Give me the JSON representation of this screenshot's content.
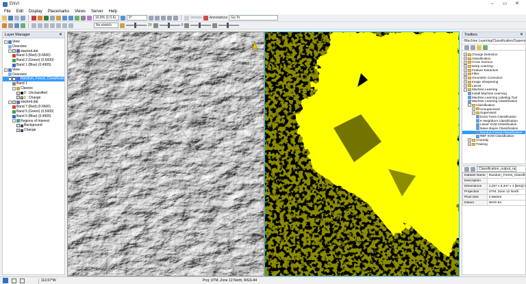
{
  "window": {
    "title": "ENVI",
    "buttons": [
      "–",
      "▭",
      "✕"
    ]
  },
  "menu": [
    "File",
    "Edit",
    "Display",
    "Placemarks",
    "Views",
    "Server",
    "Help"
  ],
  "toolbar1": {
    "zoom": "16.8% (1:0.6)",
    "rotation": "0°",
    "vectors": "Vectors",
    "annotations": "Annotations",
    "goto": "Go To"
  },
  "toolbar2": {
    "stretch": "No stretch",
    "value_a": "20",
    "value_b": "0"
  },
  "layer_manager": {
    "title": "Layer Manager",
    "tree": [
      {
        "label": "View",
        "level": 0,
        "exp": "−",
        "icon": "view"
      },
      {
        "label": "Overview",
        "level": 1,
        "icon": "overview"
      },
      {
        "label": "stacked.dat",
        "level": 1,
        "exp": "−",
        "check": true,
        "icon": "raster"
      },
      {
        "label": "Band 3 (Red) (0.6600)",
        "level": 2,
        "icon": "red-band"
      },
      {
        "label": "Band 2 (Green) (0.5600)",
        "level": 2,
        "icon": "green-band"
      },
      {
        "label": "Band 1 (Blue) (0.4905)",
        "level": 2,
        "icon": "blue-band"
      },
      {
        "label": "View",
        "level": 0,
        "exp": "−",
        "icon": "view"
      },
      {
        "label": "Overview",
        "level": 1,
        "icon": "overview"
      },
      {
        "label": "Random_Forest_Classification_",
        "level": 1,
        "exp": "−",
        "check": true,
        "icon": "raster",
        "selected": true
      },
      {
        "label": "Band 1",
        "level": 2,
        "icon": "gray-band"
      },
      {
        "label": "Classes",
        "level": 2,
        "exp": "−",
        "icon": "classes"
      },
      {
        "label": "0 : Unclassified",
        "level": 3,
        "check": true,
        "swatch": "#000000"
      },
      {
        "label": "1 : Change",
        "level": 3,
        "check": true,
        "swatch": "#ffff00"
      },
      {
        "label": "stacked.dat",
        "level": 1,
        "exp": "−",
        "check": true,
        "icon": "raster"
      },
      {
        "label": "Band 7 (Red) (0.6600)",
        "level": 2,
        "icon": "red-band"
      },
      {
        "label": "Band 5 (Green) (0.5600)",
        "level": 2,
        "icon": "green-band"
      },
      {
        "label": "Band 5 (Blue) (0.4905)",
        "level": 2,
        "icon": "blue-band"
      },
      {
        "label": "Regions of Interest",
        "level": 2,
        "exp": "−",
        "icon": "roi"
      },
      {
        "label": "Background",
        "level": 3,
        "check": true,
        "swatch": "#2f8f2f"
      },
      {
        "label": "Change",
        "level": 3,
        "check": true,
        "swatch": "#3060d0"
      }
    ]
  },
  "toolbox": {
    "title": "Toolbox",
    "path": "/Machine Learning/Classification/Supervised/R",
    "tree": [
      {
        "label": "Change Detection",
        "level": 0,
        "type": "folder"
      },
      {
        "label": "Classification",
        "level": 0,
        "type": "folder"
      },
      {
        "label": "Cross Science",
        "level": 0,
        "type": "folder"
      },
      {
        "label": "Deep Learning",
        "level": 0,
        "type": "folder"
      },
      {
        "label": "Feature Extraction",
        "level": 0,
        "type": "folder"
      },
      {
        "label": "Filter",
        "level": 0,
        "type": "folder"
      },
      {
        "label": "Geometric Correction",
        "level": 0,
        "type": "folder"
      },
      {
        "label": "Image Sharpening",
        "level": 0,
        "type": "folder"
      },
      {
        "label": "LiDAR",
        "level": 0,
        "type": "folder"
      },
      {
        "label": "Machine Learning",
        "level": 0,
        "type": "folder",
        "open": true
      },
      {
        "label": "Install Machine Learning",
        "level": 1,
        "type": "tool"
      },
      {
        "label": "Machine Learning Labeling Tool",
        "level": 1,
        "type": "tool"
      },
      {
        "label": "Machine Learning Classification",
        "level": 1,
        "type": "tool"
      },
      {
        "label": "Classification",
        "level": 1,
        "type": "folder",
        "open": true
      },
      {
        "label": "Unsupervised",
        "level": 2,
        "type": "folder"
      },
      {
        "label": "Supervised",
        "level": 2,
        "type": "folder",
        "open": true
      },
      {
        "label": "Extra Trees Classification",
        "level": 3,
        "type": "tool"
      },
      {
        "label": "K-Neighbors Classification",
        "level": 3,
        "type": "tool"
      },
      {
        "label": "Linear SVM Classification",
        "level": 3,
        "type": "tool"
      },
      {
        "label": "Naive Bayes Classification",
        "level": 3,
        "type": "tool"
      },
      {
        "label": "Random Forest Classification",
        "level": 3,
        "type": "tool",
        "selected": true
      },
      {
        "label": "RBF SVM Classification",
        "level": 3,
        "type": "tool"
      },
      {
        "label": "Anomaly",
        "level": 1,
        "type": "folder"
      },
      {
        "label": "Training",
        "level": 1,
        "type": "folder"
      }
    ]
  },
  "properties": {
    "selector": "Classification_output_raster_2",
    "rows": [
      {
        "key": "Dataset Name",
        "value": "Random_Forest_Classification_"
      },
      {
        "key": "Description",
        "value": ""
      },
      {
        "key": "Dimensions",
        "value": "4,257 x 5,347 x 1 [BSQ] Byte"
      },
      {
        "key": "Projection",
        "value": "UTM, Zone 12 North"
      },
      {
        "key": "Pixel Size",
        "value": "3 Meters"
      },
      {
        "key": "Datum",
        "value": "WGS-84"
      }
    ]
  },
  "status": {
    "coord": "112.67°W",
    "projection": "Proj: UTM, Zone 12 North, WGS-84"
  },
  "colors": {
    "accent": "#3399ff",
    "class_change": "#ffff00",
    "class_unclassified": "#000000",
    "view_border": "#2bb5d8"
  }
}
